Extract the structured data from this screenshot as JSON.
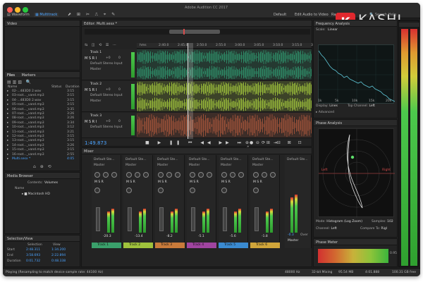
{
  "app": {
    "title": "Adobe Audition CC 2017"
  },
  "toolbar": {
    "waveform_label": "Waveform",
    "multitrack_label": "Multitrack",
    "workspaces": [
      "Default",
      "Edit Audio to Video",
      "Radi..."
    ],
    "search_label": "Search Help"
  },
  "video_panel": {
    "title": "Video"
  },
  "files_panel": {
    "tabs": [
      "Files",
      "Markers"
    ],
    "columns": [
      "Name",
      "Status",
      "Duration"
    ],
    "items": [
      {
        "name": "02-...483D0 2.wav",
        "duration": "3:15"
      },
      {
        "name": "03-root..._vand.mp3",
        "duration": "3:15"
      },
      {
        "name": "04-...483D0 2.wav",
        "duration": "3:15"
      },
      {
        "name": "05-root..._vand.mp3",
        "duration": "3:15"
      },
      {
        "name": "06-root..._vand.mp3",
        "duration": "3:35"
      },
      {
        "name": "07-root..._vand.mp3",
        "duration": "3:26"
      },
      {
        "name": "08-root..._vand.mp3",
        "duration": "3:26"
      },
      {
        "name": "09-root..._vand.mp3",
        "duration": "3:34"
      },
      {
        "name": "10-root..._vand.mp3",
        "duration": "3:12"
      },
      {
        "name": "11-root..._vand.mp3",
        "duration": "3:21"
      },
      {
        "name": "12-root..._vand.mp3",
        "duration": "3:15"
      },
      {
        "name": "13-root..._vand.mp3",
        "duration": "3:15"
      },
      {
        "name": "14-root..._vand.mp3",
        "duration": "3:26"
      },
      {
        "name": "15-root..._vand.mp3",
        "duration": "3:15"
      },
      {
        "name": "16-root..._vand.mp3",
        "duration": "2:55"
      },
      {
        "name": "Multi.sesx *",
        "duration": "4:05"
      }
    ]
  },
  "media_browser": {
    "title": "Media Browser",
    "contents_label": "Contents:",
    "contents_value": "Volumes",
    "name_col": "Name",
    "items": [
      "Macintosh HD"
    ]
  },
  "selection_view": {
    "title": "Selection/View",
    "cols": [
      "Selection",
      "View"
    ],
    "rows": [
      {
        "label": "Start",
        "sel": "2:48.311",
        "view": "1:34.200"
      },
      {
        "label": "End",
        "sel": "3:58.693",
        "view": "2:22.894"
      },
      {
        "label": "Duration",
        "sel": "0:01.732",
        "view": "0:48.338"
      }
    ]
  },
  "editor": {
    "title": "Editor: Multi.sesx *",
    "mixer_tab": "Mixer",
    "ruler": [
      "hms",
      "2:40.0",
      "2:45.0",
      "2:50.0",
      "2:55.0",
      "3:00.0",
      "3:05.0",
      "3:10.0",
      "3:15.0",
      "3:20.0"
    ],
    "time": "1:49.873",
    "tracks": [
      {
        "name": "Track 1",
        "volume": "+0",
        "pan": "0",
        "label": "Default Stereo Input",
        "read": "Master",
        "color": "#2f8f6a"
      },
      {
        "name": "Track 2",
        "volume": "+0",
        "pan": "0",
        "label": "Default Stereo Input",
        "read": "Master",
        "color": "#9fc23c"
      },
      {
        "name": "Track 3",
        "volume": "+0",
        "pan": "0",
        "label": "Default Stereo Input",
        "read": "Master",
        "color": "#a4553a"
      }
    ]
  },
  "mixer": {
    "strips": [
      {
        "name": "Track 1",
        "value": "-20.3",
        "color": "#3aa06b"
      },
      {
        "name": "Track 2",
        "value": "-13.4",
        "color": "#9fc23c"
      },
      {
        "name": "Track 3",
        "value": "-8.2",
        "color": "#c87a3a"
      },
      {
        "name": "Track 4",
        "value": "-5.1",
        "color": "#a044a0"
      },
      {
        "name": "Track 5",
        "value": "-5.6",
        "color": "#3a8ad0"
      },
      {
        "name": "Track 6",
        "value": "-1.8",
        "color": "#d0a53a"
      }
    ],
    "master": {
      "name": "Master",
      "value": "-0.3",
      "label": "Over"
    },
    "input_label": "Default Ste...",
    "output_label": "Master"
  },
  "frequency": {
    "title": "Frequency Analysis",
    "scale_label": "Scale:",
    "scale_value": "Linear",
    "freq_axis": [
      "1k",
      "5k",
      "10k",
      "15k",
      "20k"
    ],
    "db_axis": [
      "0",
      "-20",
      "-40",
      "-60",
      "-80"
    ],
    "display_label": "Display:",
    "display_value": "Lines",
    "top_channel_label": "Top Channel:",
    "top_channel_value": "Left",
    "advanced_label": "Advanced"
  },
  "phase": {
    "title": "Phase Analysis",
    "left_label": "Left",
    "right_label": "Right",
    "mode_label": "Mode:",
    "mode_value": "Histogram (Log Zoom)",
    "samples_label": "Samples:",
    "samples_value": "102",
    "channel_label": "Channel:",
    "channel_value": "Left",
    "compare_label": "Compare To:",
    "compare_value": "Rigl"
  },
  "phase_meter": {
    "title": "Phase Meter",
    "value": "0.95"
  },
  "status": {
    "left": "Playing (Resampling to match device sample rate: 44100 Hz)",
    "right": [
      "48000 Hz",
      "32-bit Mixing",
      "95.54 MB",
      "4:01.888",
      "100.31 GB free"
    ]
  },
  "watermark": {
    "letter": "K",
    "text": "KASHI"
  },
  "colors": {
    "accent": "#4aa3ff",
    "wave_green": "#3aa06b",
    "wave_lime": "#9fc23c",
    "wave_rust": "#a4553a",
    "playhead": "#c8c8c8"
  }
}
